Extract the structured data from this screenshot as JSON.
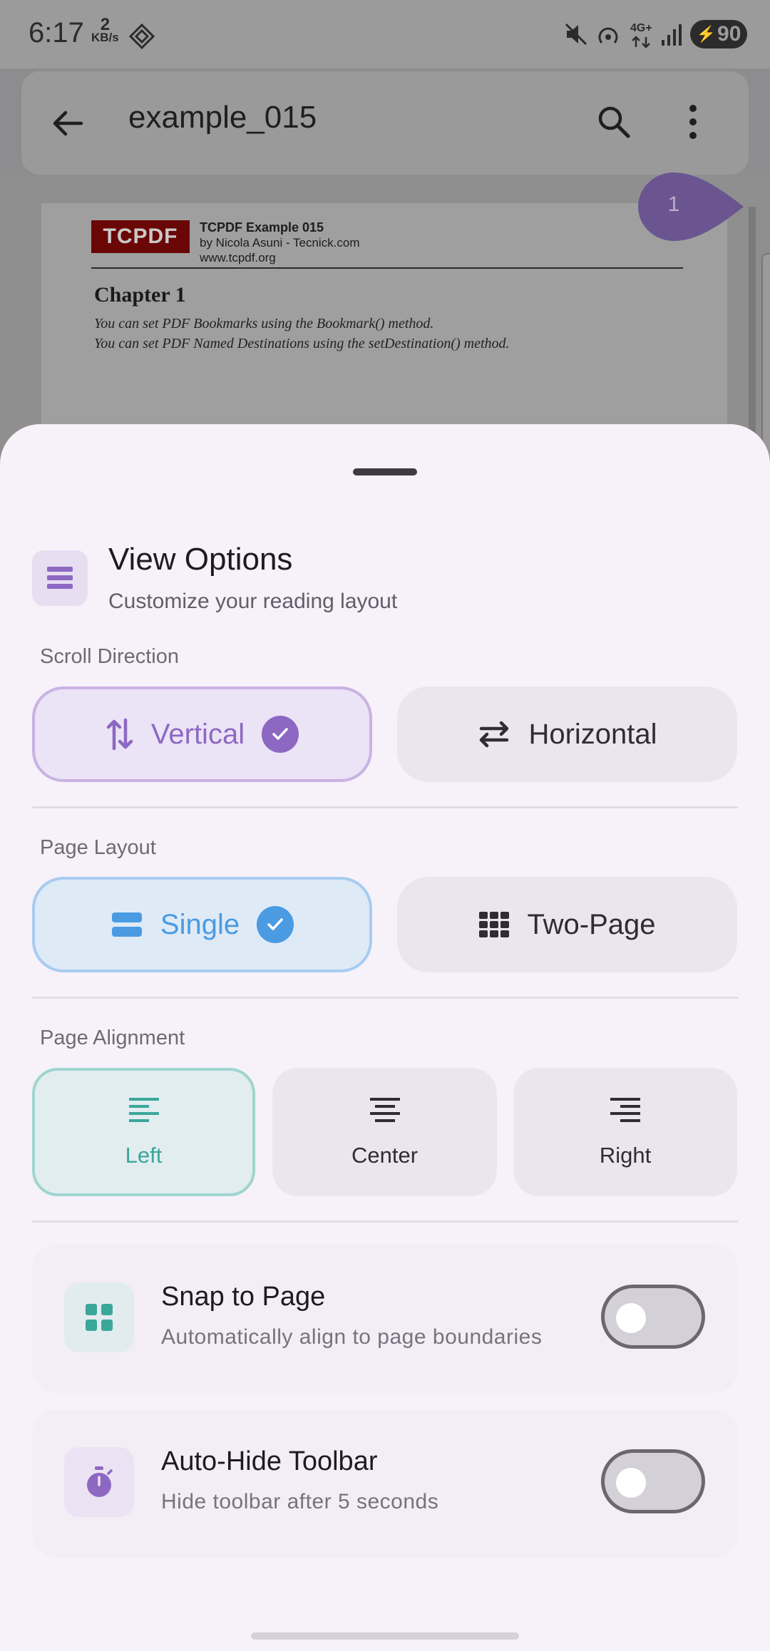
{
  "status_bar": {
    "time": "6:17",
    "net_speed_value": "2",
    "net_speed_unit": "KB/s",
    "network": "4G+",
    "battery": "90"
  },
  "app_bar": {
    "title": "example_015",
    "back_icon": "arrow-left-icon",
    "search_icon": "search-icon",
    "more_icon": "more-vert-icon"
  },
  "pdf": {
    "logo_text": "TCPDF",
    "header_title": "TCPDF Example 015",
    "header_author": "by Nicola Asuni - Tecnick.com",
    "header_url": "www.tcpdf.org",
    "chapter_title": "Chapter 1",
    "line1": "You can set PDF Bookmarks using the Bookmark() method.",
    "line2": "You can set PDF Named Destinations using the setDestination() method.",
    "page_indicator": "1"
  },
  "sheet": {
    "title": "View Options",
    "subtitle": "Customize your reading layout",
    "scroll_direction": {
      "label": "Scroll Direction",
      "options": [
        {
          "label": "Vertical",
          "selected": true
        },
        {
          "label": "Horizontal",
          "selected": false
        }
      ]
    },
    "page_layout": {
      "label": "Page Layout",
      "options": [
        {
          "label": "Single",
          "selected": true
        },
        {
          "label": "Two-Page",
          "selected": false
        }
      ]
    },
    "page_alignment": {
      "label": "Page Alignment",
      "options": [
        {
          "label": "Left",
          "selected": true
        },
        {
          "label": "Center",
          "selected": false
        },
        {
          "label": "Right",
          "selected": false
        }
      ]
    },
    "snap_to_page": {
      "title": "Snap to Page",
      "subtitle": "Automatically align to page boundaries",
      "enabled": false
    },
    "auto_hide_toolbar": {
      "title": "Auto-Hide Toolbar",
      "subtitle": "Hide toolbar after 5 seconds",
      "enabled": false
    }
  },
  "colors": {
    "accent_purple": "#8d68c2",
    "accent_blue": "#4a9be2",
    "accent_teal": "#3aa79a"
  }
}
